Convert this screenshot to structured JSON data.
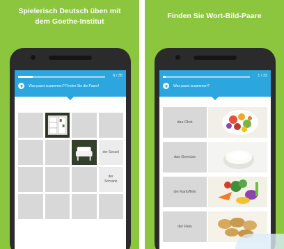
{
  "left_panel": {
    "headline_line1": "Spielerisch Deutsch üben mit",
    "headline_line2": "dem Goethe-Institut",
    "counter": "6 / 35",
    "progress": 0.17,
    "instruction": "Was passt zusammen? Finden Sie die Paare!",
    "tiles": [
      {
        "kind": "blank"
      },
      {
        "kind": "image",
        "icon": "shelf-cabinet-icon"
      },
      {
        "kind": "blank"
      },
      {
        "kind": "blank"
      },
      {
        "kind": "blank"
      },
      {
        "kind": "blank"
      },
      {
        "kind": "image",
        "icon": "armchair-icon"
      },
      {
        "kind": "word",
        "label": "der Sessel"
      },
      {
        "kind": "blank"
      },
      {
        "kind": "blank"
      },
      {
        "kind": "blank"
      },
      {
        "kind": "word",
        "label": "der Schrank"
      },
      {
        "kind": "blank"
      },
      {
        "kind": "blank"
      },
      {
        "kind": "blank"
      },
      {
        "kind": "blank"
      }
    ]
  },
  "right_panel": {
    "headline": "Finden Sie Wort-Bild-Paare",
    "counter": "1 / 33",
    "progress": 0.03,
    "instruction": "Was passt zusammen?",
    "rows": [
      {
        "word": "das Obst",
        "icon": "fruit-bowl-icon"
      },
      {
        "word": "das Gemüse",
        "icon": "rice-bowl-icon"
      },
      {
        "word": "die Kartoffeln",
        "icon": "vegetables-icon"
      },
      {
        "word": "der Reis",
        "icon": "potatoes-icon"
      }
    ]
  },
  "colors": {
    "background": "#8cc63f",
    "appbar": "#2ba6de",
    "tile": "#d8d8d8",
    "phone": "#2b2b2b"
  }
}
